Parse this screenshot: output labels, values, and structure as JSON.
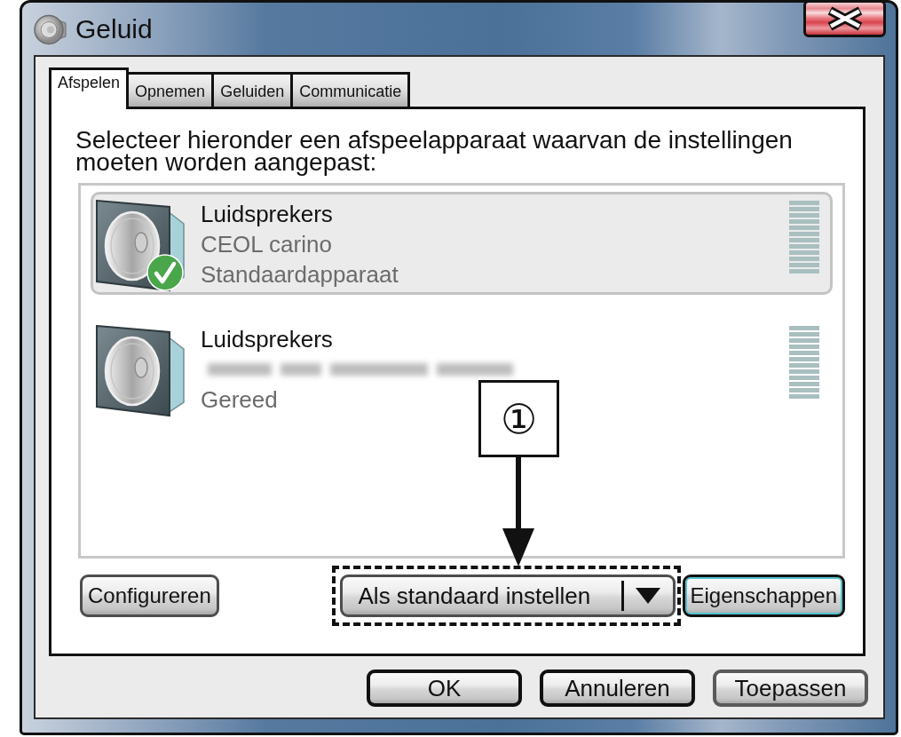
{
  "window": {
    "title": "Geluid"
  },
  "tabs": [
    {
      "label": "Afspelen",
      "selected": true
    },
    {
      "label": "Opnemen",
      "selected": false
    },
    {
      "label": "Geluiden",
      "selected": false
    },
    {
      "label": "Communicatie",
      "selected": false
    }
  ],
  "instruction": "Selecteer hieronder een afspeelapparaat waarvan de instellingen moeten worden aangepast:",
  "devices": [
    {
      "name": "Luidsprekers",
      "detail": "CEOL carino",
      "detail_blurred": false,
      "status": "Standaardapparaat",
      "selected": true,
      "default": true
    },
    {
      "name": "Luidsprekers",
      "detail_blurred": true,
      "status": "Gereed",
      "selected": false,
      "default": false
    }
  ],
  "panel_buttons": [
    {
      "kind": "button",
      "label": "Configureren",
      "focused": false,
      "highlighted": false
    },
    {
      "kind": "split",
      "label": "Als standaard instellen",
      "focused": false,
      "highlighted": true
    },
    {
      "kind": "button",
      "label": "Eigenschappen",
      "focused": true,
      "highlighted": false
    }
  ],
  "callout": {
    "label": "①"
  },
  "dialog_buttons": [
    {
      "label": "OK",
      "emphasized": true
    },
    {
      "label": "Annuleren",
      "emphasized": true
    },
    {
      "label": "Toepassen",
      "emphasized": false
    }
  ]
}
